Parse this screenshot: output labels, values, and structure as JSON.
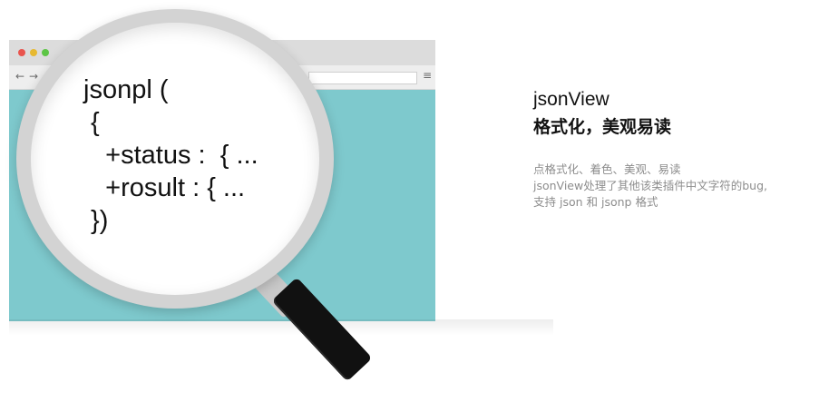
{
  "window": {
    "traffic_lights": [
      "#e9544d",
      "#e7b931",
      "#5cc545"
    ],
    "content_color": "#7ec9cd",
    "nav": {
      "back": "←",
      "forward": "→",
      "menu": "≡"
    }
  },
  "magnifier": {
    "code_lines": [
      "jsonpl (",
      " {",
      "   +status :  { ...",
      "   +rosult : { ...",
      " })"
    ]
  },
  "feature": {
    "title": "jsonView",
    "subtitle": "格式化，美观易读",
    "description": [
      "点格式化、着色、美观、易读",
      " jsonView处理了其他该类插件中文字符的bug,",
      "支持 json 和 jsonp 格式"
    ]
  }
}
